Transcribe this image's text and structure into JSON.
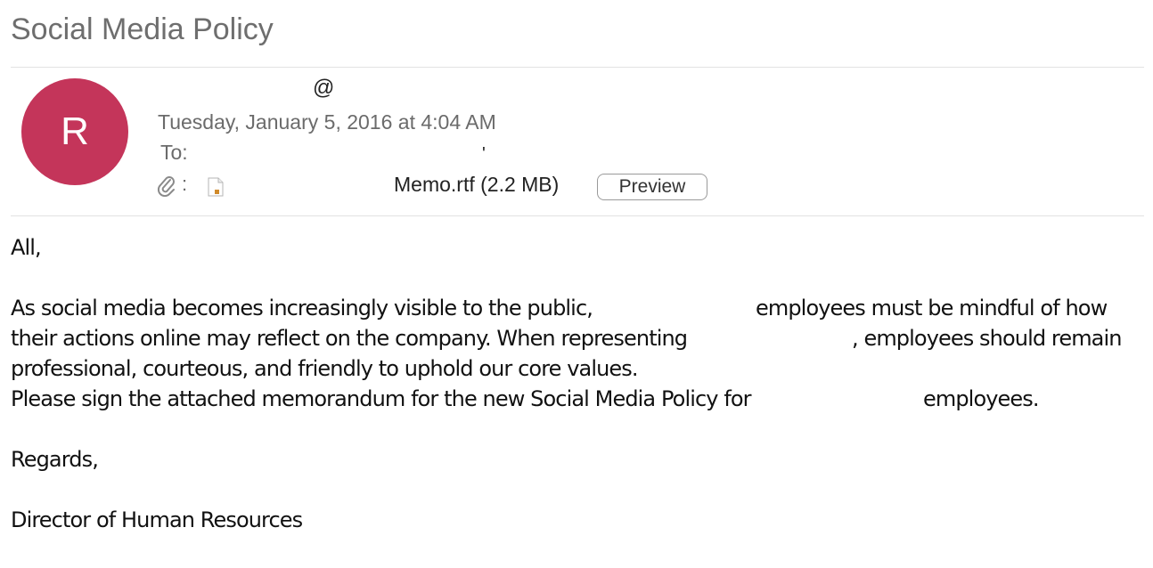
{
  "email": {
    "subject": "Social Media Policy",
    "avatar_initial": "R",
    "sender_visible": "@",
    "date": "Tuesday, January 5, 2016 at 4:04 AM",
    "to_label": "To:",
    "to_mark": "'",
    "attachment": {
      "colon": ":",
      "filename": "Memo.rtf (2.2 MB)",
      "preview_label": "Preview"
    }
  },
  "body": {
    "greeting": "All,",
    "p1_l1_a": "As social media becomes increasingly visible to the public,",
    "p1_l1_b": "employees must be mindful of how",
    "p1_l2_a": "their actions online may reflect on the company. When representing",
    "p1_l2_b": ", employees should remain",
    "p1_l3": "professional, courteous, and friendly to uphold our core values.",
    "p2_a": "Please sign the attached memorandum for the new Social Media Policy for",
    "p2_b": "employees.",
    "closing": "Regards,",
    "signature": "Director of Human Resources"
  },
  "icons": {
    "paperclip": "paperclip-icon",
    "file": "rtf-file-icon"
  },
  "colors": {
    "avatar_bg": "#c4355a",
    "subject_text": "#6e6e6e",
    "meta_text": "#6b6b6b"
  }
}
